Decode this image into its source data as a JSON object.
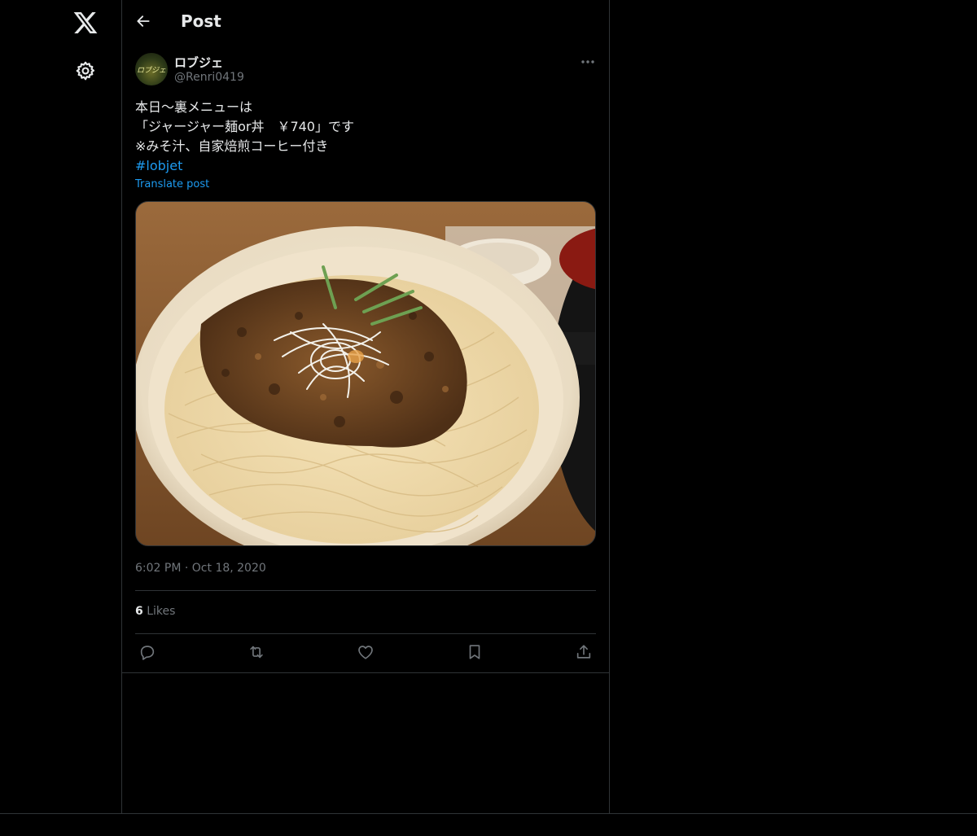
{
  "header": {
    "title": "Post"
  },
  "sidebar": {
    "logo": "x-logo-icon",
    "settings": "gear-icon"
  },
  "post": {
    "avatar_text": "ロブジェ",
    "display_name": "ロブジェ",
    "handle": "@Renri0419",
    "text_lines": [
      "本日〜裏メニューは",
      "「ジャージャー麺or丼　￥740」です",
      "※みそ汁、自家焙煎コーヒー付き"
    ],
    "hashtag": "#lobjet",
    "translate_label": "Translate post",
    "time": "6:02 PM",
    "separator": "·",
    "date": "Oct 18, 2020",
    "likes_count": "6",
    "likes_label": "Likes"
  },
  "actions": [
    "reply-icon",
    "repost-icon",
    "like-icon",
    "bookmark-icon",
    "share-icon"
  ],
  "colors": {
    "background": "#000000",
    "text": "#e7e9ea",
    "muted": "#71767b",
    "accent": "#1d9bf0",
    "border": "#2f3336"
  }
}
